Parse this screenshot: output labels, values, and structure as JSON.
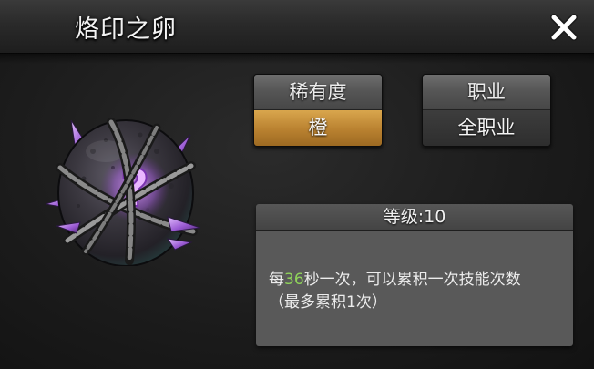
{
  "window": {
    "title": "烙印之卵",
    "close_icon": "close-x-icon"
  },
  "item": {
    "icon": "chained-mystery-egg-icon",
    "rarity_label": "稀有度",
    "rarity_value": "橙",
    "job_label": "职业",
    "job_value": "全职业"
  },
  "info": {
    "level_text": "等级:10",
    "desc_prefix": "每",
    "desc_seconds": "36",
    "desc_suffix": "秒一次，可以累积一次技能次数",
    "desc_line2": "（最多累积1次）"
  },
  "colors": {
    "rarity_orange": "#c48a35",
    "highlight_green": "#8fd35a",
    "egg_purple": "#b27ae0"
  }
}
